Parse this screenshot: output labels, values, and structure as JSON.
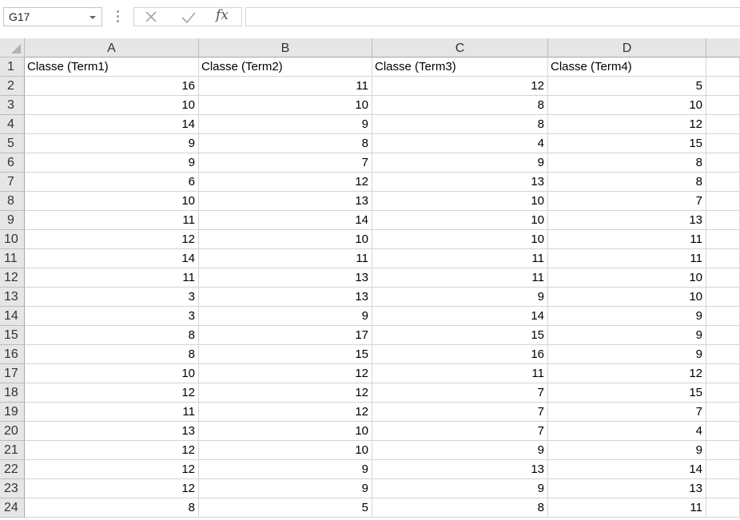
{
  "name_box": {
    "value": "G17"
  },
  "formula_bar": {
    "value": ""
  },
  "icons": {
    "cancel": "cancel-x-icon",
    "enter": "check-enter-icon",
    "fx": "fx"
  },
  "columns": [
    "A",
    "B",
    "C",
    "D"
  ],
  "header_row": [
    "Classe (Term1)",
    "Classe (Term2)",
    "Classe (Term3)",
    "Classe (Term4)"
  ],
  "row_numbers": [
    "1",
    "2",
    "3",
    "4",
    "5",
    "6",
    "7",
    "8",
    "9",
    "10",
    "11",
    "12",
    "13",
    "14",
    "15",
    "16",
    "17",
    "18",
    "19",
    "20",
    "21",
    "22",
    "23",
    "24"
  ],
  "rows": [
    [
      "16",
      "11",
      "12",
      "5"
    ],
    [
      "10",
      "10",
      "8",
      "10"
    ],
    [
      "14",
      "9",
      "8",
      "12"
    ],
    [
      "9",
      "8",
      "4",
      "15"
    ],
    [
      "9",
      "7",
      "9",
      "8"
    ],
    [
      "6",
      "12",
      "13",
      "8"
    ],
    [
      "10",
      "13",
      "10",
      "7"
    ],
    [
      "11",
      "14",
      "10",
      "13"
    ],
    [
      "12",
      "10",
      "10",
      "11"
    ],
    [
      "14",
      "11",
      "11",
      "11"
    ],
    [
      "11",
      "13",
      "11",
      "10"
    ],
    [
      "3",
      "13",
      "9",
      "10"
    ],
    [
      "3",
      "9",
      "14",
      "9"
    ],
    [
      "8",
      "17",
      "15",
      "9"
    ],
    [
      "8",
      "15",
      "16",
      "9"
    ],
    [
      "10",
      "12",
      "11",
      "12"
    ],
    [
      "12",
      "12",
      "7",
      "15"
    ],
    [
      "11",
      "12",
      "7",
      "7"
    ],
    [
      "13",
      "10",
      "7",
      "4"
    ],
    [
      "12",
      "10",
      "9",
      "9"
    ],
    [
      "12",
      "9",
      "13",
      "14"
    ],
    [
      "12",
      "9",
      "9",
      "13"
    ],
    [
      "8",
      "5",
      "8",
      "11"
    ]
  ]
}
